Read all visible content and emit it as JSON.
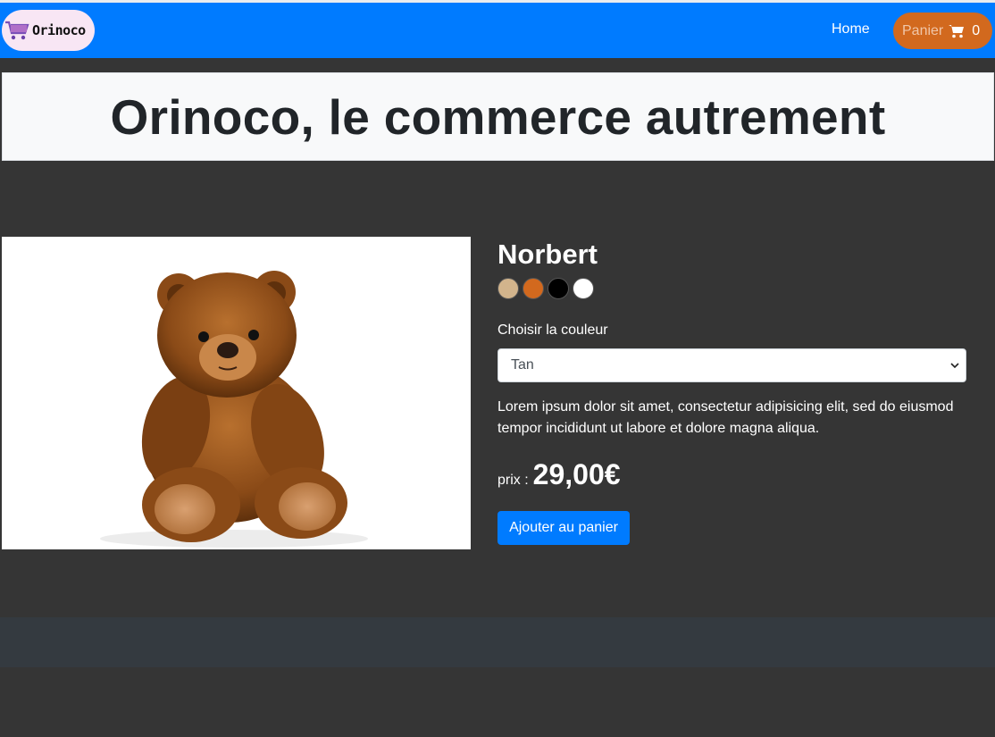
{
  "header": {
    "logo_text": "Orinoco",
    "nav_home": "Home",
    "cart": {
      "label": "Panier",
      "count": "0"
    }
  },
  "hero": {
    "title": "Orinoco, le commerce autrement"
  },
  "product": {
    "name": "Norbert",
    "colors": [
      "#d2b48c",
      "#d2691e",
      "#000000",
      "#ffffff"
    ],
    "color_label": "Choisir la couleur",
    "selected_color": "Tan",
    "description": "Lorem ipsum dolor sit amet, consectetur adipisicing elit, sed do eiusmod tempor incididunt ut labore et dolore magna aliqua.",
    "price_label": "prix :",
    "price": "29,00€",
    "add_button": "Ajouter au panier"
  },
  "theme": {
    "navbar": "#007bff",
    "cart_button": "#d2691e",
    "background": "#353535",
    "footer": "#343a40"
  }
}
